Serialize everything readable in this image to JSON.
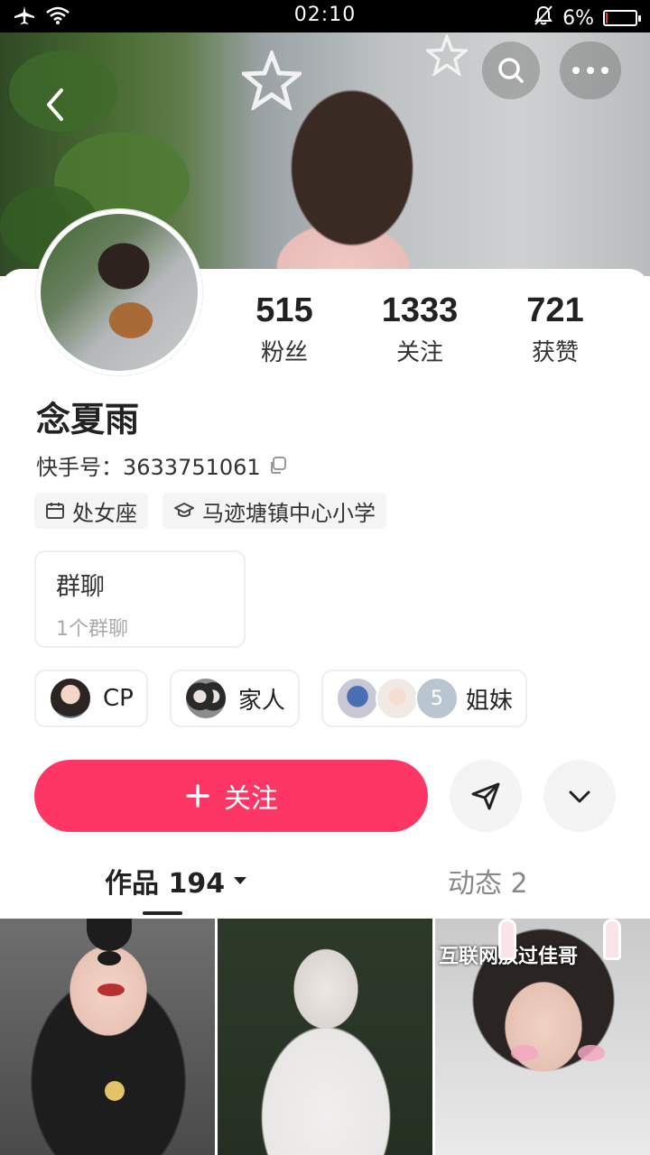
{
  "status_bar": {
    "time": "02:10",
    "battery_text": "6%",
    "battery_level": 0.06,
    "battery_color": "#e53935"
  },
  "header": {
    "back_icon": "chevron-left-icon",
    "search_icon": "search-icon",
    "more_icon": "more-horizontal-icon"
  },
  "profile": {
    "nickname": "念夏雨",
    "uid_label": "快手号：",
    "uid_value": "3633751061",
    "stats": [
      {
        "value": "515",
        "label": "粉丝"
      },
      {
        "value": "1333",
        "label": "关注"
      },
      {
        "value": "721",
        "label": "获赞"
      }
    ],
    "tags": [
      {
        "icon": "calendar-icon",
        "text": "处女座"
      },
      {
        "icon": "school-icon",
        "text": "马迹塘镇中心小学"
      }
    ],
    "group": {
      "title": "群聊",
      "subtitle": "1个群聊"
    },
    "relations": [
      {
        "label": "CP"
      },
      {
        "label": "家人"
      },
      {
        "label": "姐妹",
        "count": "5"
      }
    ]
  },
  "actions": {
    "follow_label": "关注",
    "follow_color": "#fe3666"
  },
  "tabs": {
    "works": "作品 194",
    "moments": "动态 2"
  },
  "thumbnails": {
    "third_caption": "互联网放过佳哥"
  }
}
